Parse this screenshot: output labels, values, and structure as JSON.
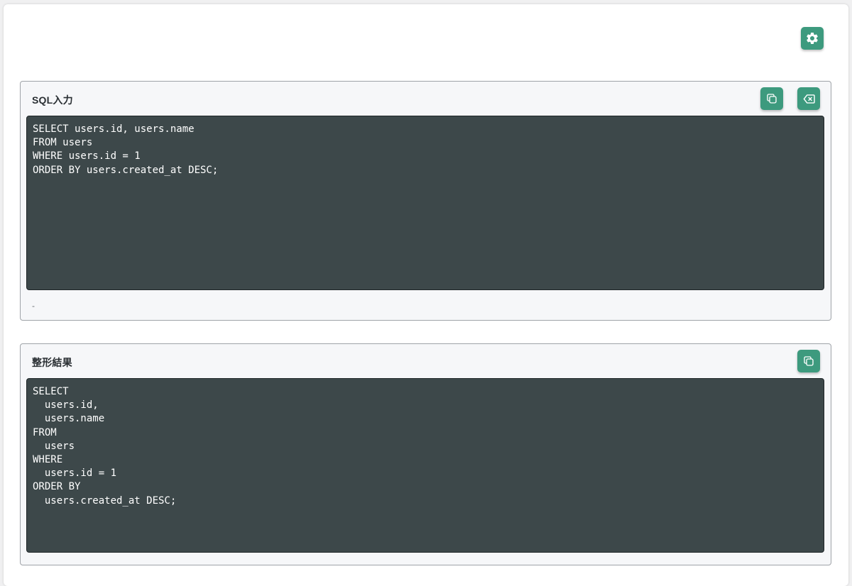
{
  "settings": {
    "icon": "gear-icon",
    "accent_color": "#3d9a7e"
  },
  "input_panel": {
    "title": "SQL入力",
    "copy_icon": "copy-icon",
    "clear_icon": "backspace-icon",
    "sql": "SELECT users.id, users.name\nFROM users\nWHERE users.id = 1\nORDER BY users.created_at DESC;",
    "status": "-"
  },
  "output_panel": {
    "title": "整形結果",
    "copy_icon": "copy-icon",
    "formatted_sql": "SELECT\n  users.id,\n  users.name\nFROM\n  users\nWHERE\n  users.id = 1\nORDER BY\n  users.created_at DESC;"
  },
  "colors": {
    "editor_background": "#3d484a",
    "panel_background": "#f6f7f9"
  }
}
